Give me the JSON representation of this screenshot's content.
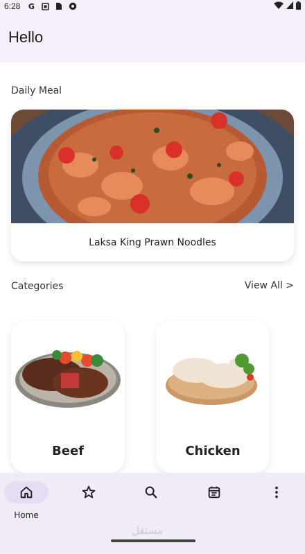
{
  "status_bar": {
    "time": "6:28",
    "left_icons": [
      "google-icon",
      "notification-icon",
      "sim-icon",
      "soccer-icon"
    ],
    "right_icons": [
      "wifi-icon",
      "signal-icon",
      "battery-icon"
    ]
  },
  "app_bar": {
    "title": "Hello"
  },
  "daily_meal": {
    "section_label": "Daily Meal",
    "title": "Laksa King Prawn Noodles"
  },
  "categories": {
    "section_label": "Categories",
    "view_all_label": "View All >",
    "items": [
      {
        "label": "Beef"
      },
      {
        "label": "Chicken"
      }
    ]
  },
  "bottom_nav": {
    "items": [
      {
        "label": "Home",
        "icon": "home-icon",
        "active": true
      },
      {
        "label": "",
        "icon": "star-icon",
        "active": false
      },
      {
        "label": "",
        "icon": "search-icon",
        "active": false
      },
      {
        "label": "",
        "icon": "calendar-icon",
        "active": false
      },
      {
        "label": "",
        "icon": "more-vert-icon",
        "active": false
      }
    ]
  },
  "watermark": "مستقل",
  "colors": {
    "app_background": "#f4eff8",
    "nav_background": "#f1ebf6",
    "active_pill": "#e6ddf4",
    "card_background": "#ffffff"
  }
}
